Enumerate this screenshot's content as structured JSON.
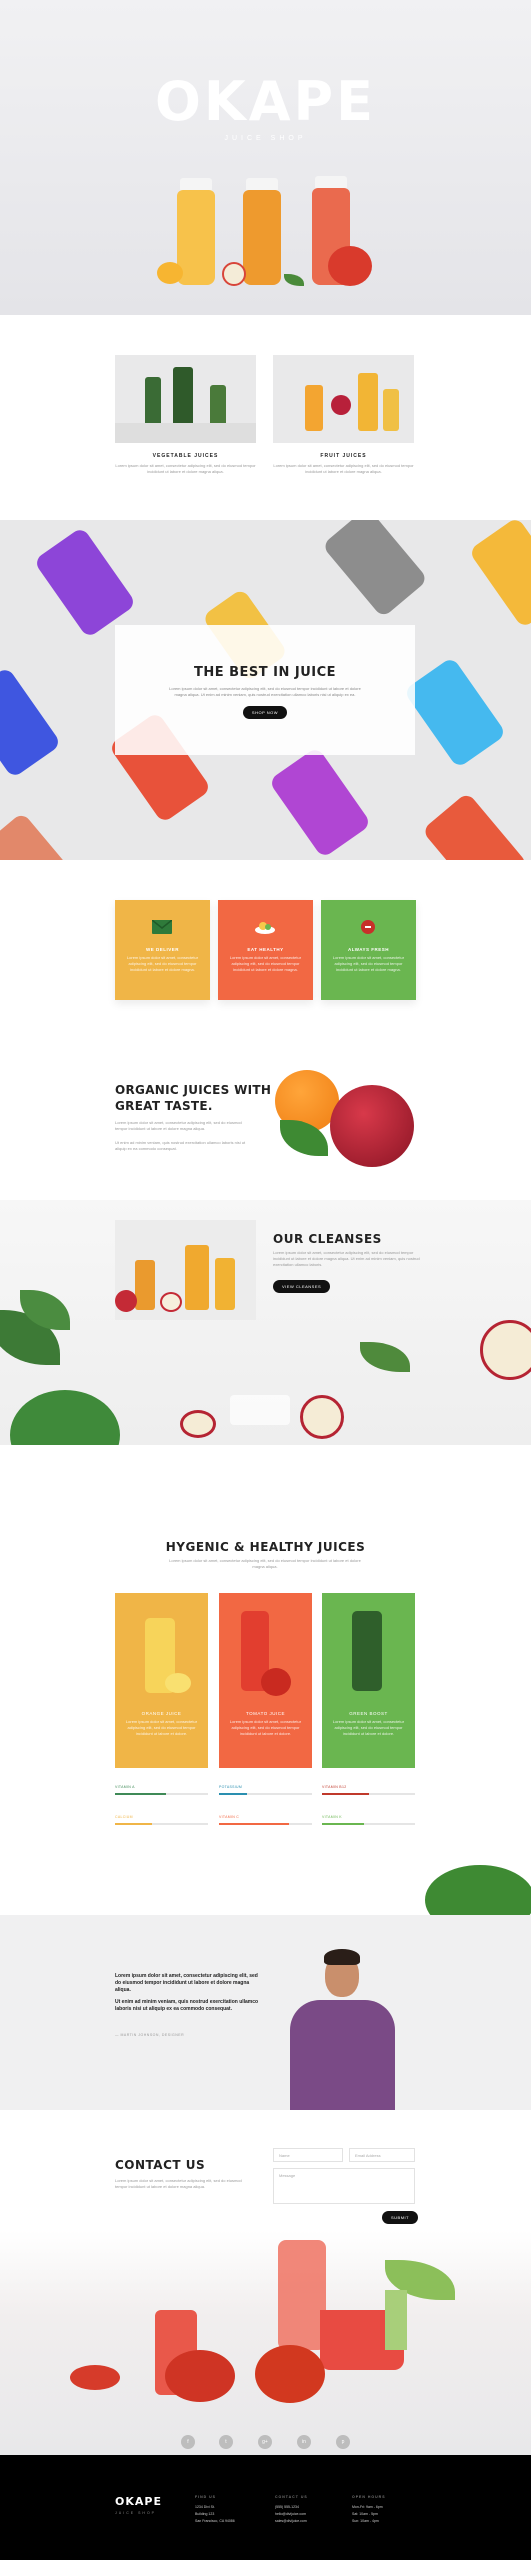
{
  "hero": {
    "title": "OKAPE",
    "subtitle": "JUICE SHOP"
  },
  "products": [
    {
      "title": "VEGETABLE JUICES",
      "text": "Lorem ipsum dolor sit amet, consectetur adipiscing elit, sed do eiusmod tempor incididunt ut labore et dolore magna aliqua."
    },
    {
      "title": "FRUIT JUICES",
      "text": "Lorem ipsum dolor sit amet, consectetur adipiscing elit, sed do eiusmod tempor incididunt ut labore et dolore magna aliqua."
    }
  ],
  "best": {
    "title": "THE BEST IN JUICE",
    "text": "Lorem ipsum dolor sit amet, consectetur adipiscing elit, sed do eiusmod tempor incididunt ut labore et dolore magna aliqua. Ut enim ad minim veniam, quis nostrud exercitation ullamco laboris nisi ut aliquip ex ea.",
    "button": "SHOP NOW"
  },
  "features": [
    {
      "title": "WE DELIVER",
      "text": "Lorem ipsum dolor sit amet, consectetur adipiscing elit, sed do eiusmod tempor incididunt ut labore et dolore magna.",
      "color": "#f0b547",
      "icon": "envelope-icon"
    },
    {
      "title": "EAT HEALTHY",
      "text": "Lorem ipsum dolor sit amet, consectetur adipiscing elit, sed do eiusmod tempor incididunt ut labore et dolore magna.",
      "color": "#f26843",
      "icon": "food-icon"
    },
    {
      "title": "ALWAYS FRESH",
      "text": "Lorem ipsum dolor sit amet, consectetur adipiscing elit, sed do eiusmod tempor incididunt ut labore et dolore magna.",
      "color": "#6ab650",
      "icon": "fruit-icon"
    }
  ],
  "organic": {
    "title": "ORGANIC JUICES WITH GREAT TASTE.",
    "text1": "Lorem ipsum dolor sit amet, consectetur adipiscing elit, sed do eiusmod tempor incididunt ut labore et dolore magna aliqua.",
    "text2": "Ut enim ad minim veniam, quis nostrud exercitation ullamco laboris nisi ut aliquip ex ea commodo consequat."
  },
  "cleanses": {
    "title": "OUR CLEANSES",
    "text": "Lorem ipsum dolor sit amet, consectetur adipiscing elit, sed do eiusmod tempor incididunt ut labore et dolore magna aliqua. Ut enim ad minim veniam, quis nostrud exercitation ullamco laboris.",
    "button": "VIEW CLEANSES"
  },
  "hygenic": {
    "title": "HYGENIC & HEALTHY JUICES",
    "text": "Lorem ipsum dolor sit amet, consectetur adipiscing elit, sed do eiusmod tempor incididunt ut labore et dolore magna aliqua.",
    "juices": [
      {
        "name": "ORANGE JUICE",
        "text": "Lorem ipsum dolor sit amet, consectetur adipiscing elit, sed do eiusmod tempor incididunt ut labore et dolore.",
        "color": "#f0b547",
        "bars": [
          {
            "label": "VITAMIN A",
            "value": 0.55,
            "color": "#3f8a57"
          },
          {
            "label": "CALCIUM",
            "value": 0.4,
            "color": "#f0b547"
          }
        ]
      },
      {
        "name": "TOMATO JUICE",
        "text": "Lorem ipsum dolor sit amet, consectetur adipiscing elit, sed do eiusmod tempor incididunt ut labore et dolore.",
        "color": "#f26843",
        "bars": [
          {
            "label": "POTASSIUM",
            "value": 0.3,
            "color": "#2a8fb0"
          },
          {
            "label": "VITAMIN C",
            "value": 0.75,
            "color": "#f26843"
          }
        ]
      },
      {
        "name": "GREEN BOOST",
        "text": "Lorem ipsum dolor sit amet, consectetur adipiscing elit, sed do eiusmod tempor incididunt ut labore et dolore.",
        "color": "#6ab650",
        "bars": [
          {
            "label": "VITAMIN B12",
            "value": 0.5,
            "color": "#c0392b"
          },
          {
            "label": "VITAMIN K",
            "value": 0.45,
            "color": "#6ab650"
          }
        ]
      }
    ]
  },
  "testimonial": {
    "quote1": "Lorem ipsum dolor sit amet, consectetur adipiscing elit, sed do eiusmod tempor incididunt ut labore et dolore magna aliqua.",
    "quote2": "Ut enim ad minim veniam, quis nostrud exercitation ullamco laboris nisi ut aliquip ex ea commodo consequat.",
    "author": "— MARTIN JOHNSON, DESIGNER"
  },
  "contact": {
    "title": "CONTACT US",
    "text": "Lorem ipsum dolor sit amet, consectetur adipiscing elit, sed do eiusmod tempor incididunt ut labore et dolore magna aliqua.",
    "name_placeholder": "Name",
    "email_placeholder": "Email Address",
    "message_placeholder": "Message",
    "submit": "SUBMIT",
    "social": [
      "f",
      "t",
      "g+",
      "in",
      "p"
    ]
  },
  "footer": {
    "logo": "OKAPE",
    "sub": "JUICE SHOP",
    "columns": [
      {
        "title": "FIND US",
        "lines": [
          "1234 Divi St.",
          "Building 123",
          "San Francisco, CA 94086"
        ]
      },
      {
        "title": "CONTACT US",
        "lines": [
          "(555) 555-1234",
          "hello@divijuice.com",
          "sales@divijuice.com"
        ]
      },
      {
        "title": "OPEN HOURS",
        "lines": [
          "Mon-Fri: 9am - 6pm",
          "Sat: 10am - 5pm",
          "Sun: 10am - 4pm"
        ]
      }
    ]
  }
}
